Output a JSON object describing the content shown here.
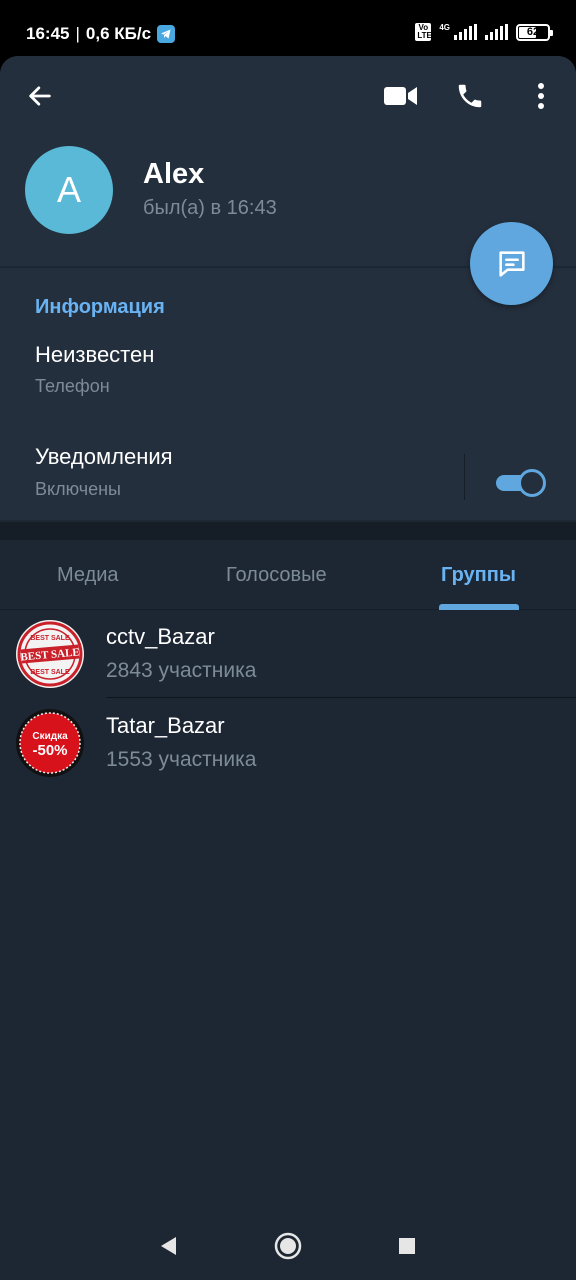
{
  "status_bar": {
    "time": "16:45",
    "separator": "|",
    "speed": "0,6 КБ/с",
    "volte": "Vo LTE",
    "network": "4G",
    "battery": "62"
  },
  "header": {
    "avatar_letter": "A",
    "name": "Alex",
    "last_seen": "был(а) в 16:43"
  },
  "info": {
    "title": "Информация",
    "phone_value": "Неизвестен",
    "phone_label": "Телефон",
    "notifications_value": "Уведомления",
    "notifications_label": "Включены",
    "notifications_on": true
  },
  "tabs": [
    {
      "label": "Медиа",
      "active": false
    },
    {
      "label": "Голосовые",
      "active": false
    },
    {
      "label": "Группы",
      "active": true
    }
  ],
  "groups": [
    {
      "name": "cctv_Bazar",
      "members": "2843 участника",
      "avatar_icon": "best-sale-stamp-icon",
      "avatar_text": "BEST SALE"
    },
    {
      "name": "Tatar_Bazar",
      "members": "1553 участника",
      "avatar_icon": "discount-badge-icon",
      "avatar_text_top": "Скидка",
      "avatar_text_bottom": "-50%"
    }
  ],
  "colors": {
    "background": "#1d2733",
    "header": "#242f3d",
    "accent": "#6ab3f3",
    "fab": "#5fa7de",
    "avatar": "#5ab9d6",
    "secondary_text": "#7d8b99"
  },
  "nav": {
    "back_icon": "triangle-back-icon",
    "home_icon": "circle-home-icon",
    "recents_icon": "square-recents-icon"
  }
}
